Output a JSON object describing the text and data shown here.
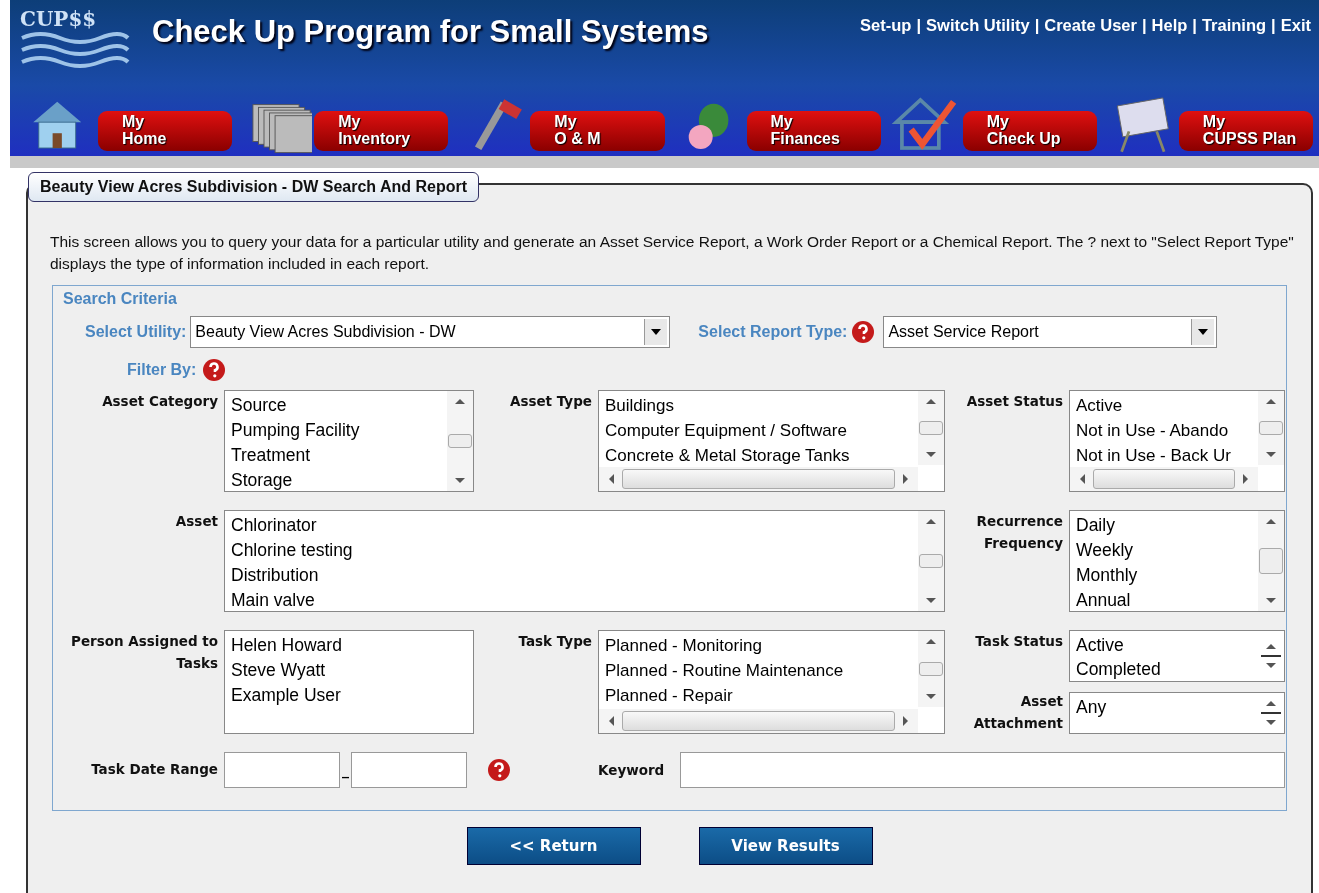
{
  "app": {
    "logo": "CUP$$",
    "title": "Check Up Program for Small Systems"
  },
  "top_links": [
    "Set-up",
    "Switch Utility",
    "Create User",
    "Help",
    "Training",
    "Exit"
  ],
  "link_separator": "|",
  "nav": [
    {
      "line1": "My",
      "line2": "Home"
    },
    {
      "line1": "My",
      "line2": "Inventory"
    },
    {
      "line1": "My",
      "line2": "O & M"
    },
    {
      "line1": "My",
      "line2": "Finances"
    },
    {
      "line1": "My",
      "line2": "Check Up"
    },
    {
      "line1": "My",
      "line2": "CUPSS Plan"
    }
  ],
  "panel": {
    "tab": "Beauty View Acres Subdivision - DW Search And Report",
    "intro": "This screen allows you to query your data for a particular utility and generate an Asset Service Report, a Work Order Report or a Chemical Report. The ? next to \"Select Report Type\" displays the type of information included in each report."
  },
  "search": {
    "legend": "Search Criteria",
    "utility_label": "Select Utility:",
    "utility_value": "Beauty View Acres Subdivision - DW",
    "report_label": "Select Report Type:",
    "report_value": "Asset Service Report",
    "filter_label": "Filter By:"
  },
  "lists": [
    {
      "label": "Asset Category",
      "kind": "vscroll",
      "items": [
        "Source",
        "Pumping Facility",
        "Treatment",
        "Storage"
      ]
    },
    {
      "label": "Asset Type",
      "kind": "both",
      "items": [
        "Buildings",
        "Computer Equipment / Software",
        "Concrete & Metal Storage Tanks"
      ]
    },
    {
      "label": "Asset Status",
      "kind": "both",
      "items": [
        "Active",
        "Not in Use - Abando",
        "Not in Use - Back Ur"
      ]
    },
    {
      "label": "Asset",
      "kind": "vscroll",
      "items": [
        "Chlorinator",
        "Chlorine testing",
        "Distribution",
        "Main valve"
      ]
    },
    {
      "label": "Recurrence Frequency",
      "kind": "vscroll",
      "items": [
        "Daily",
        "Weekly",
        "Monthly",
        "Annual"
      ]
    },
    {
      "label": "Person Assigned to Tasks",
      "kind": "plain",
      "items": [
        "Helen Howard",
        "Steve Wyatt",
        "Example User"
      ]
    },
    {
      "label": "Task Type",
      "kind": "both",
      "items": [
        "Planned - Monitoring",
        "Planned - Routine Maintenance",
        "Planned - Repair"
      ]
    },
    {
      "label": "Task Status",
      "kind": "spin",
      "items": [
        "Active",
        "Completed"
      ]
    },
    {
      "label": "Asset Attachment",
      "kind": "spin",
      "items": [
        "Any"
      ]
    }
  ],
  "date_range": {
    "label": "Task Date Range",
    "separator": "_"
  },
  "keyword": {
    "label": "Keyword"
  },
  "buttons": [
    "<< Return",
    "View Results"
  ]
}
